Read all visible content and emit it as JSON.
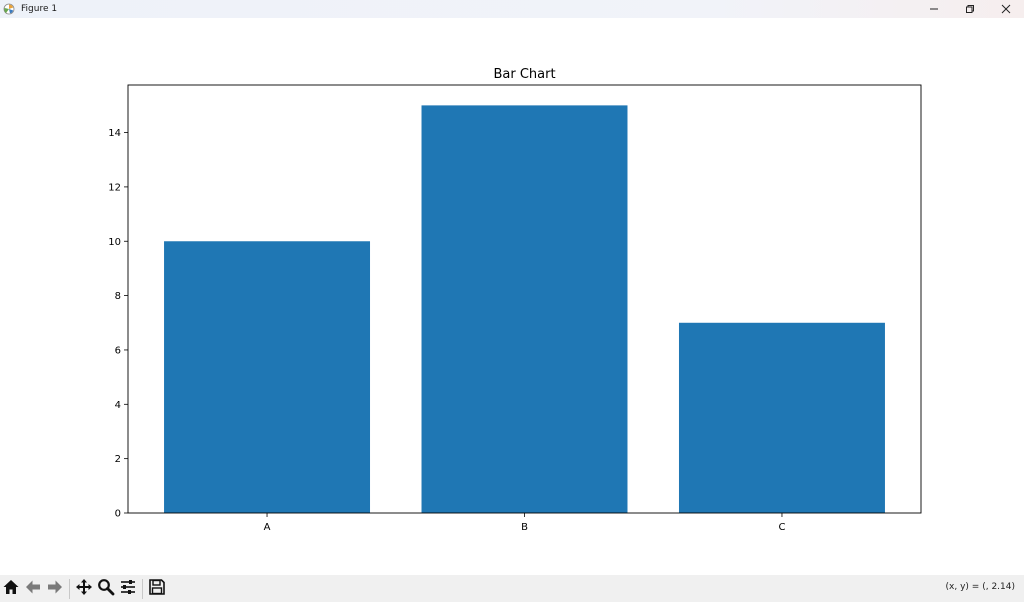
{
  "window": {
    "title": "Figure 1",
    "minimize_icon": "minimize-icon",
    "maximize_icon": "restore-icon",
    "close_icon": "close-icon"
  },
  "toolbar": {
    "tools": [
      {
        "name": "home",
        "icon": "home-icon"
      },
      {
        "name": "back",
        "icon": "arrow-left-icon"
      },
      {
        "name": "forward",
        "icon": "arrow-right-icon"
      },
      {
        "name": "pan",
        "icon": "move-icon"
      },
      {
        "name": "zoom",
        "icon": "magnifier-icon"
      },
      {
        "name": "configure",
        "icon": "sliders-icon"
      },
      {
        "name": "save",
        "icon": "floppy-disk-icon"
      }
    ],
    "coords_text": "(x, y) = (, 2.14)"
  },
  "colors": {
    "bar": "#1f77b4",
    "axes": "#000000",
    "toolbar_bg": "#f0f0f0"
  },
  "chart_data": {
    "type": "bar",
    "title": "Bar Chart",
    "categories": [
      "A",
      "B",
      "C"
    ],
    "values": [
      10,
      15,
      7
    ],
    "xlabel": "",
    "ylabel": "",
    "ylim": [
      0,
      15.75
    ],
    "yticks": [
      0,
      2,
      4,
      6,
      8,
      10,
      12,
      14
    ],
    "grid": false,
    "legend": "none"
  }
}
